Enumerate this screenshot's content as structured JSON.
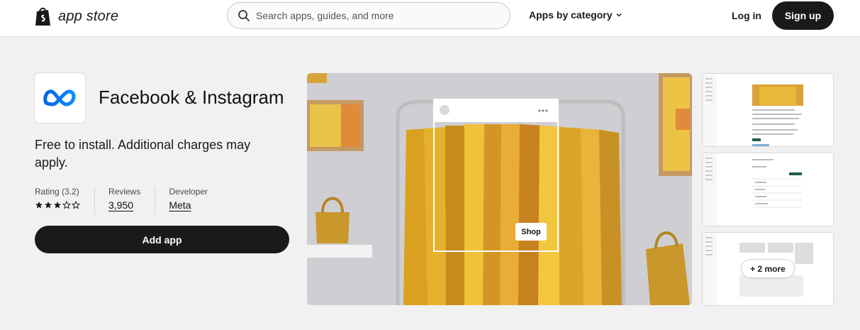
{
  "header": {
    "logo_text": "app store",
    "search_placeholder": "Search apps, guides, and more",
    "apps_by_category": "Apps by category",
    "login": "Log in",
    "signup": "Sign up"
  },
  "app": {
    "title": "Facebook & Instagram",
    "pricing": "Free to install. Additional charges may apply.",
    "rating_label": "Rating (3.2)",
    "rating_value": 3.2,
    "stars_filled": 3,
    "stars_total": 5,
    "reviews_label": "Reviews",
    "reviews_value": "3,950",
    "developer_label": "Developer",
    "developer_value": "Meta",
    "add_app": "Add app"
  },
  "media": {
    "shop_label": "Shop",
    "more_label": "+ 2 more"
  },
  "colors": {
    "primary": "#1a1a1a",
    "meta_blue": "#0a7cff",
    "brand_green": "#008060"
  }
}
